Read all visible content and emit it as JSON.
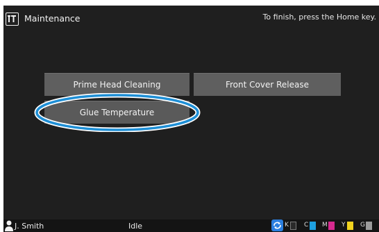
{
  "title_bar": {
    "title": "Maintenance",
    "hint": "To finish, press the Home key."
  },
  "buttons": {
    "prime_cleaning": "Prime Head Cleaning",
    "front_cover_release": "Front Cover Release",
    "glue_temperature": "Glue Temperature"
  },
  "status_bar": {
    "user": "J. Smith",
    "status": "Idle",
    "inks": [
      {
        "label": "K",
        "color": "#2a2a2a"
      },
      {
        "label": "C",
        "color": "#1ea0e0"
      },
      {
        "label": "M",
        "color": "#d62a8f"
      },
      {
        "label": "Y",
        "color": "#f0d21e"
      },
      {
        "label": "G",
        "color": "#9a9a9a"
      }
    ]
  },
  "colors": {
    "screen_bg": "#1f1f1f",
    "button_bg": "#5f5f5f",
    "highlight_ring": "#1e8fd6",
    "sync_icon": "#2b7fe0"
  },
  "icons": {
    "title": "maintenance-icon",
    "user": "user-icon",
    "sync": "sync-icon"
  }
}
